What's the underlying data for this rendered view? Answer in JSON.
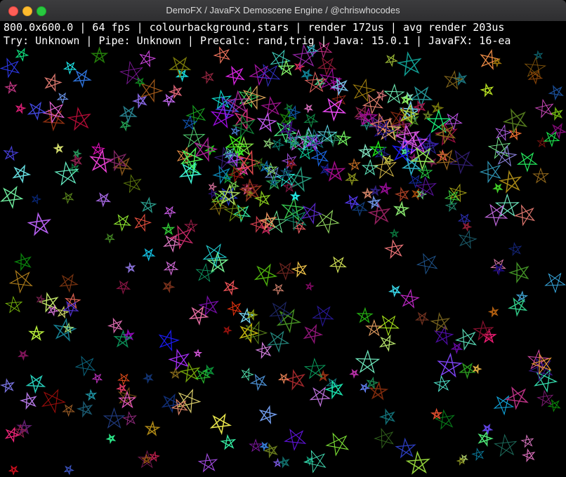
{
  "window": {
    "title": "DemoFX / JavaFX Demoscene Engine / @chriswhocodes"
  },
  "hud": {
    "line1": "800.0x600.0 | 64 fps | colourbackground,stars | render 172us | avg render 203us",
    "line2": "Try: Unknown | Pipe: Unknown | Precalc: rand,trig | Java: 15.0.1 | JavaFX: 16-ea"
  },
  "colors": {
    "close": "#ff5f57",
    "minimize": "#febc2e",
    "maximize": "#28c840",
    "background": "#000000"
  },
  "icons": [
    "close-icon",
    "minimize-icon",
    "maximize-icon",
    "star-icon"
  ]
}
